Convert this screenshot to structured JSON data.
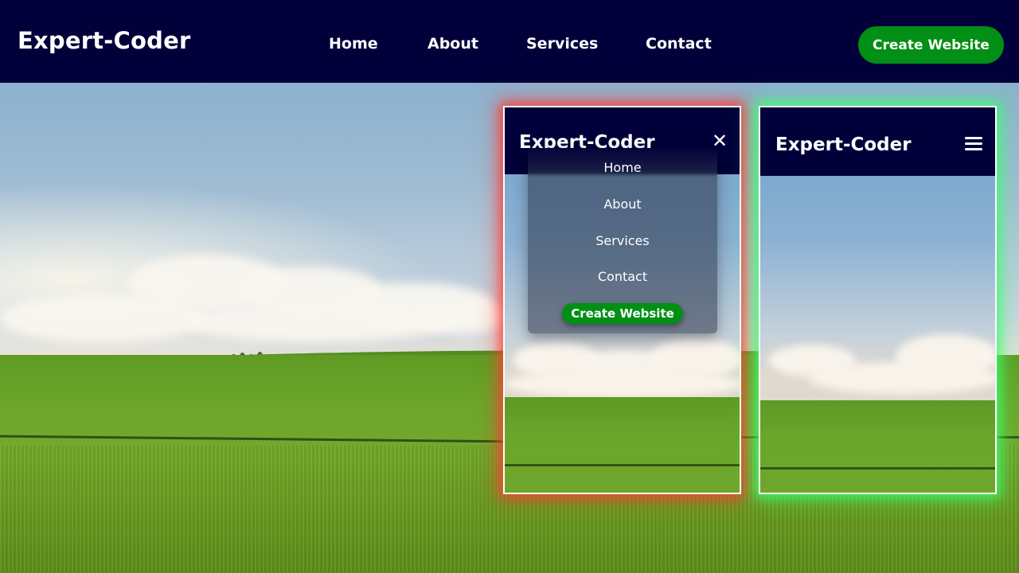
{
  "navbar": {
    "logo": "Expert-Coder",
    "links": [
      "Home",
      "About",
      "Services",
      "Contact"
    ],
    "cta": "Create Website"
  },
  "mobile_open": {
    "logo": "Expert-Coder",
    "close_icon": "close-icon",
    "menu_items": [
      "Home",
      "About",
      "Services",
      "Contact"
    ],
    "cta": "Create Website",
    "glow_color": "#ff3c32"
  },
  "mobile_closed": {
    "logo": "Expert-Coder",
    "menu_icon": "hamburger-icon",
    "glow_color": "#3cff6e"
  },
  "colors": {
    "navbar_bg": "#01003a",
    "cta_bg": "#018f15",
    "text": "#ffffff"
  }
}
